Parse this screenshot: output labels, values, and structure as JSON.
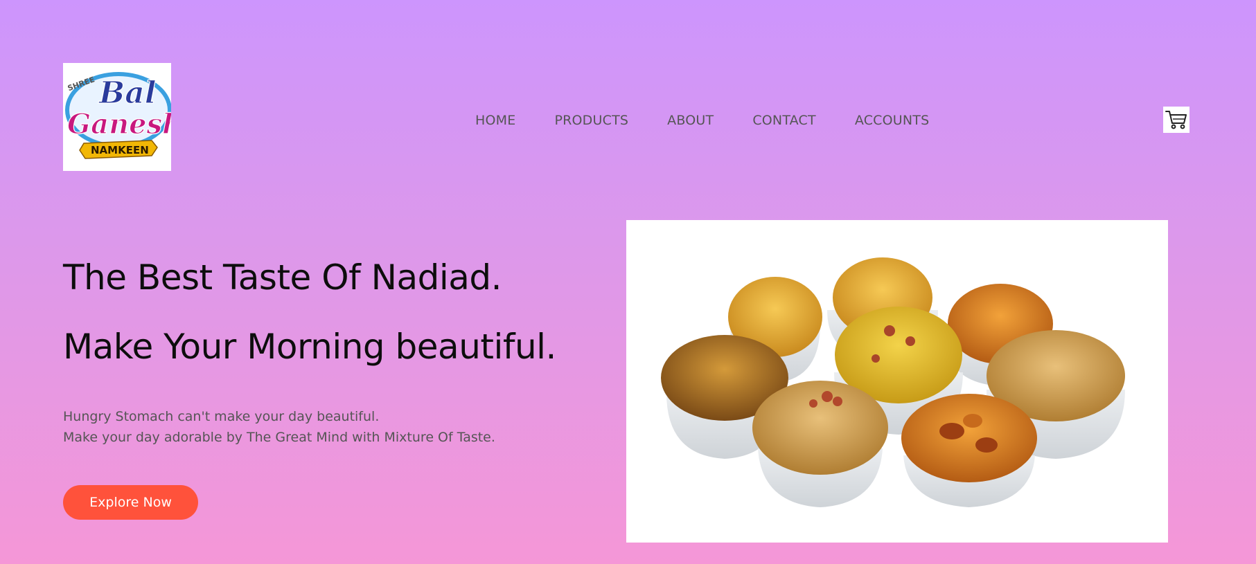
{
  "brand": {
    "logo_small": "SHREE",
    "logo_line1": "Bal",
    "logo_line2": "Ganesh",
    "logo_banner": "NAMKEEN"
  },
  "nav": {
    "items": [
      {
        "label": "HOME"
      },
      {
        "label": "PRODUCTS"
      },
      {
        "label": "ABOUT"
      },
      {
        "label": "CONTACT"
      },
      {
        "label": "ACCOUNTS"
      }
    ]
  },
  "icons": {
    "cart": "shopping-cart-icon"
  },
  "hero": {
    "headline_1": "The Best Taste Of Nadiad.",
    "headline_2": "Make Your Morning beautiful.",
    "description_line_1": "Hungry Stomach can't make your day beautiful.",
    "description_line_2": "Make your day adorable by The Great Mind with Mixture Of Taste.",
    "cta_label": "Explore Now"
  },
  "colors": {
    "background_top": "#cd95fd",
    "background_bottom": "#f597d7",
    "cta": "#ff523b",
    "nav_text": "#555555",
    "logo_blue": "#2a3b9c",
    "logo_magenta": "#c8187e",
    "logo_gold": "#f2b705"
  }
}
